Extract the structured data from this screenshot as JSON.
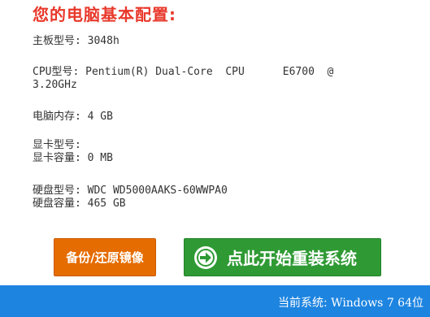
{
  "heading": "您的电脑基本配置:",
  "specs": {
    "motherboard": "主板型号: 3048h",
    "cpu_line1": "CPU型号: Pentium(R) Dual-Core  CPU      E6700  @",
    "cpu_line2": "3.20GHz",
    "memory": "电脑内存: 4 GB",
    "gpu_model": "显卡型号:",
    "gpu_memory": "显卡容量: 0 MB",
    "disk_model": "硬盘型号: WDC WD5000AAKS-60WWPA0",
    "disk_capacity": "硬盘容量: 465 GB"
  },
  "buttons": {
    "backup_label": "备份/还原镜像",
    "reinstall_label": "点此开始重装系统",
    "reinstall_icon": "arrow-right-circle-icon"
  },
  "status": {
    "label": "当前系统:",
    "value": " Windows 7 64位"
  },
  "colors": {
    "heading": "#e8392b",
    "backup_button": "#e56c00",
    "reinstall_button": "#2f9a34",
    "status_bar": "#1d84e0"
  }
}
